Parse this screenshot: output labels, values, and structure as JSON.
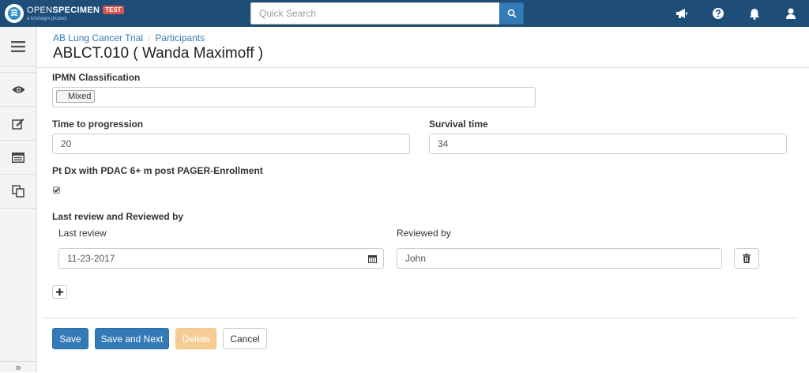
{
  "app": {
    "name_light": "OPEN",
    "name_bold": "SPECIMEN",
    "tagline": "a krishagni product",
    "env_badge": "TEST"
  },
  "search": {
    "placeholder": "Quick Search"
  },
  "header_icons": [
    "megaphone-icon",
    "help-icon",
    "bell-icon",
    "user-icon"
  ],
  "sidebar": {
    "items": [
      "menu-icon",
      "eye-icon",
      "edit-icon",
      "list-icon",
      "copy-icon"
    ],
    "expand_label": "»"
  },
  "breadcrumb": {
    "items": [
      "AB Lung Cancer Trial",
      "Participants"
    ],
    "separator": "/"
  },
  "page_title": "ABLCT.010 ( Wanda Maximoff )",
  "form": {
    "ipmn": {
      "label": "IPMN Classification",
      "tags": [
        "Mixed"
      ]
    },
    "time_to_progression": {
      "label": "Time to progression",
      "value": "20"
    },
    "survival_time": {
      "label": "Survival time",
      "value": "34"
    },
    "pt_dx": {
      "label": "Pt Dx with PDAC 6+ m post PAGER-Enrollment",
      "checked": true
    },
    "review": {
      "label": "Last review and Reviewed by",
      "last_review_label": "Last review",
      "reviewed_by_label": "Reviewed by",
      "last_review_value": "11-23-2017",
      "reviewed_by_value": "John"
    }
  },
  "actions": {
    "save": "Save",
    "save_next": "Save and Next",
    "delete": "Delete",
    "cancel": "Cancel"
  },
  "colors": {
    "navbar": "#1e4d78",
    "primary": "#337ab7",
    "warning": "#f0ad4e",
    "badge": "#d9534f",
    "link": "#337ab7"
  }
}
